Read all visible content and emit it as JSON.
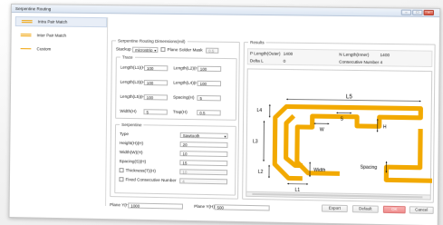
{
  "window": {
    "title": "Serpentine Routing",
    "btn_min": "–",
    "btn_max": "□",
    "btn_close": "×"
  },
  "sidebar": {
    "items": [
      {
        "label": "Intra Pair Match"
      },
      {
        "label": "Inter Pair Match"
      },
      {
        "label": "Custom"
      }
    ]
  },
  "dims": {
    "legend": "Serpentine Routing Dimensions(mil)",
    "stackup_label": "Stackup",
    "stackup_value": "microstrip",
    "plane_solder_label": "Plane Solder Mask",
    "plane_solder_value": "0.5",
    "trace": {
      "legend": "Trace",
      "fields": [
        {
          "label": "Length(L1)(H)",
          "value": "100"
        },
        {
          "label": "Length(L2)(H)",
          "value": "100"
        },
        {
          "label": "Length(L3)(H)",
          "value": "100"
        },
        {
          "label": "Length(L4)(H)",
          "value": "100"
        },
        {
          "label": "Length(L5)(H)",
          "value": "100"
        },
        {
          "label": "Spacing(H)",
          "value": "5"
        },
        {
          "label": "Width(H)",
          "value": "5"
        },
        {
          "label": "Trap(H)",
          "value": "0.5"
        }
      ]
    },
    "serpentine": {
      "legend": "Serpentine",
      "type_label": "Type",
      "type_value": "Sawtooth",
      "fields": [
        {
          "label": "Height(H)(H)",
          "value": "20"
        },
        {
          "label": "Width(W)(H)",
          "value": "10"
        },
        {
          "label": "Spacing(S)(H)",
          "value": "15"
        }
      ],
      "thickness_label": "Thickness(T)(H)",
      "thickness_value": "10",
      "fixed_label": "Fixed Consecutive Number",
      "fixed_value": "4"
    }
  },
  "results": {
    "legend": "Results",
    "p_len_label": "P Length(Outer)",
    "p_len_value": "1400",
    "n_len_label": "N Length(Inner)",
    "n_len_value": "1400",
    "delta_label": "Delta L",
    "delta_value": "0",
    "consec_label": "Consecutive Number",
    "consec_value": "4"
  },
  "diagram": {
    "labels": {
      "l5": "L5",
      "l4": "L4",
      "l3": "L3",
      "l2": "L2",
      "l1": "L1",
      "w": "W",
      "s": "S",
      "h": "H",
      "width": "Width",
      "spacing": "Spacing"
    },
    "trace_color": "#f2a900"
  },
  "footer": {
    "plane_x_label": "Plane Y(H)",
    "plane_x_value": "1000",
    "plane_y_label": "Plane Y(H)",
    "plane_y_value": "500",
    "export": "Export",
    "default": "Default",
    "ok": "OK",
    "cancel": "Cancel"
  }
}
